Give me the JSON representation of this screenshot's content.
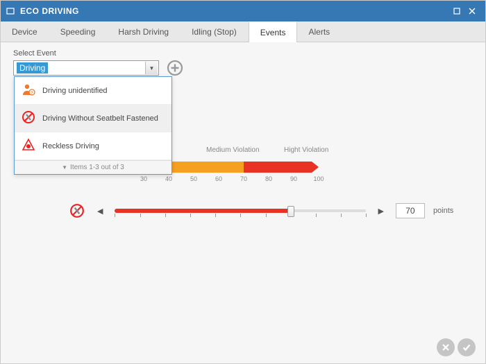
{
  "window": {
    "title": "ECO DRIVING"
  },
  "tabs": {
    "items": [
      {
        "label": "Device"
      },
      {
        "label": "Speeding"
      },
      {
        "label": "Harsh Driving"
      },
      {
        "label": "Idling (Stop)"
      },
      {
        "label": "Events"
      },
      {
        "label": "Alerts"
      }
    ],
    "active_index": 4
  },
  "select": {
    "label": "Select Event",
    "value": "Driving",
    "options": [
      {
        "icon": "person-question",
        "label": "Driving unidentified"
      },
      {
        "icon": "no-seatbelt",
        "label": "Driving Without Seatbelt Fastened"
      },
      {
        "icon": "reckless",
        "label": "Reckless Driving"
      }
    ],
    "footer": "Items 1-3 out of 3"
  },
  "gauge": {
    "labels": {
      "medium": "Medium Violation",
      "high": "Hight Violation"
    },
    "ticks": [
      "30",
      "40",
      "50",
      "60",
      "70",
      "80",
      "90",
      "100"
    ]
  },
  "slider": {
    "value": "70",
    "unit": "points"
  }
}
